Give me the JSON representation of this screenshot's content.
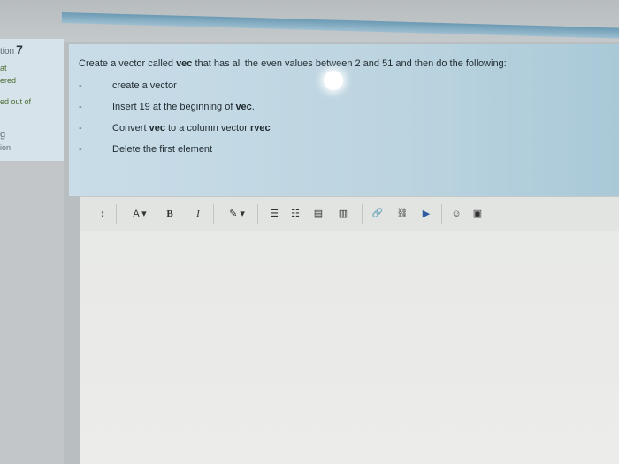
{
  "info": {
    "question_label": "tion",
    "question_number": "7",
    "line1": "at",
    "line2": "ered",
    "line3": "ed out of",
    "line4": "g",
    "line5": "ion"
  },
  "question": {
    "intro_prefix": "Create a vector called ",
    "intro_bold": "vec",
    "intro_suffix": " that has all the even values between 2 and 51  and then do the following:",
    "items": [
      {
        "dash": "-",
        "text_a": "create a vector",
        "bold": "",
        "text_b": ""
      },
      {
        "dash": "-",
        "text_a": "Insert 19 at the beginning of ",
        "bold": "vec",
        "text_b": "."
      },
      {
        "dash": "-",
        "text_a": "Convert  ",
        "bold": "vec",
        "text_b": " to a column vector "
      },
      {
        "dash": "-",
        "text_a": "Delete the first element",
        "bold": "",
        "text_b": ""
      }
    ],
    "item3_bold2": "rvec"
  },
  "toolbar": {
    "paragraph": "↕",
    "font": "A ▾",
    "bold": "B",
    "italic": "I",
    "color": "✎ ▾",
    "ul": "☰",
    "ol": "☷",
    "indent": "▤",
    "outdent": "▥",
    "link": "🔗",
    "unlink": "⛓",
    "media": "▶",
    "emoji": "☺",
    "image": "▣"
  }
}
